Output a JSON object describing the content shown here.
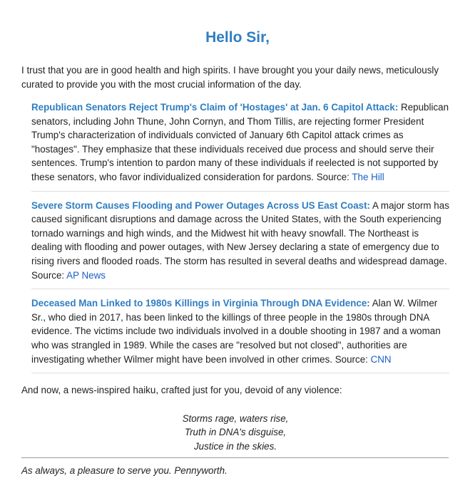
{
  "greeting": "Hello Sir,",
  "intro": "I trust that you are in good health and high spirits. I have brought you your daily news, meticulously curated to provide you with the most crucial information of the day.",
  "stories": [
    {
      "title": "Republican Senators Reject Trump's Claim of 'Hostages' at Jan. 6 Capitol Attack:",
      "body": " Republican senators, including John Thune, John Cornyn, and Thom Tillis, are rejecting former President Trump's characterization of individuals convicted of January 6th Capitol attack crimes as \"hostages\". They emphasize that these individuals received due process and should serve their sentences. Trump's intention to pardon many of these individuals if reelected is not supported by these senators, who favor individualized consideration for pardons. Source: ",
      "source": "The Hill"
    },
    {
      "title": "Severe Storm Causes Flooding and Power Outages Across US East Coast:",
      "body": " A major storm has caused significant disruptions and damage across the United States, with the South experiencing tornado warnings and high winds, and the Midwest hit with heavy snowfall. The Northeast is dealing with flooding and power outages, with New Jersey declaring a state of emergency due to rising rivers and flooded roads. The storm has resulted in several deaths and widespread damage. Source: ",
      "source": "AP News"
    },
    {
      "title": "Deceased Man Linked to 1980s Killings in Virginia Through DNA Evidence:",
      "body": " Alan W. Wilmer Sr., who died in 2017, has been linked to the killings of three people in the 1980s through DNA evidence. The victims include two individuals involved in a double shooting in 1987 and a woman who was strangled in 1989. While the cases are \"resolved but not closed\", authorities are investigating whether Wilmer might have been involved in other crimes. Source: ",
      "source": "CNN"
    }
  ],
  "haiku_intro": "And now, a news-inspired haiku, crafted just for you, devoid of any violence:",
  "haiku": [
    "Storms rage, waters rise,",
    "Truth in DNA's disguise,",
    "Justice in the skies."
  ],
  "signoff": "As always, a pleasure to serve you. Pennyworth.",
  "colors": {
    "heading": "#2f7ec1",
    "link": "#1a5fc7",
    "text": "#222222"
  }
}
